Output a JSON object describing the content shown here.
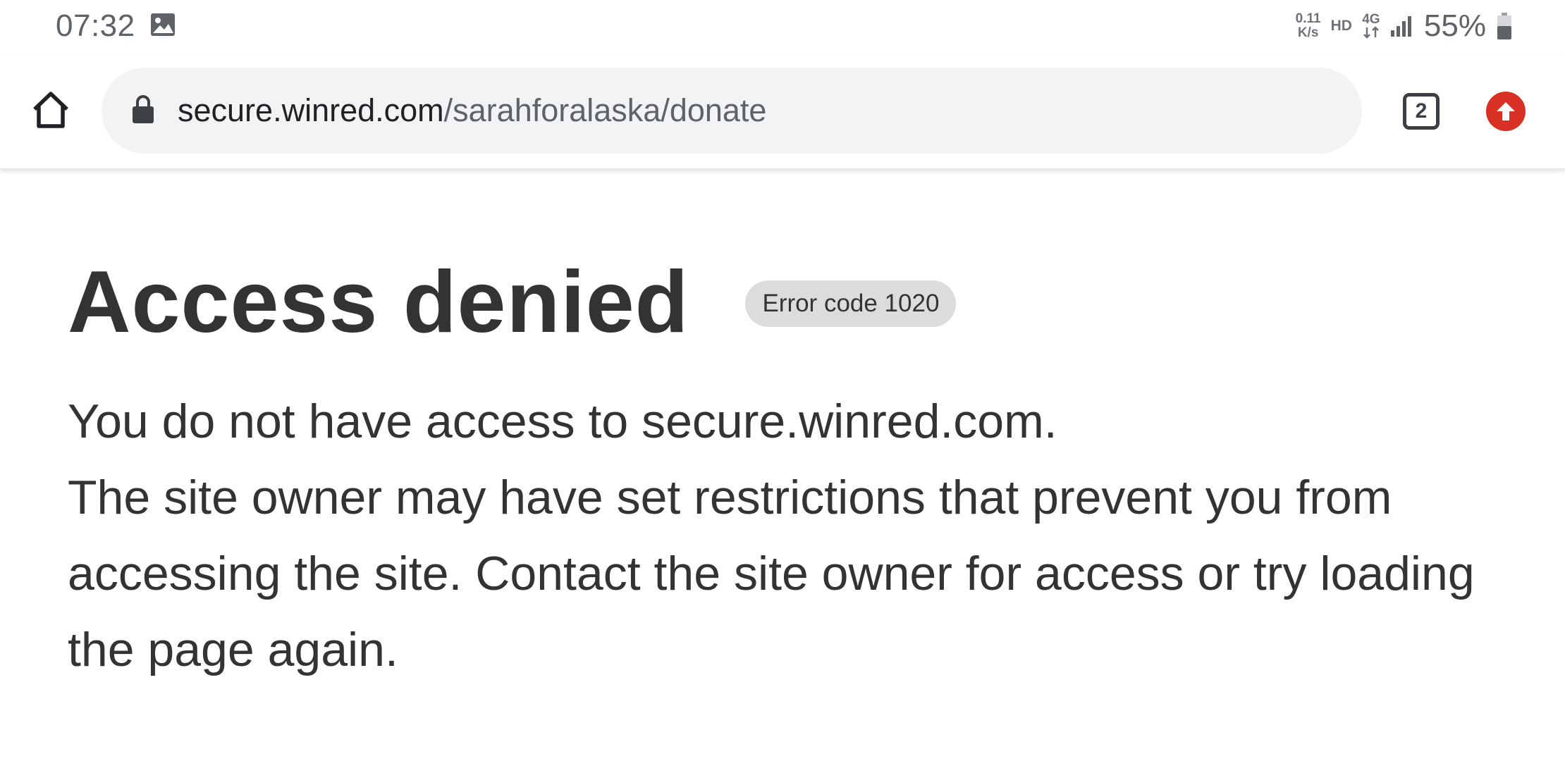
{
  "status_bar": {
    "time": "07:32",
    "net_speed_value": "0.11",
    "net_speed_unit": "K/s",
    "hd": "HD",
    "network_type": "4G",
    "battery": "55%"
  },
  "browser": {
    "url_domain": "secure.winred.com",
    "url_path": "/sarahforalaska/donate",
    "tab_count": "2"
  },
  "page": {
    "title": "Access denied",
    "error_badge": "Error code 1020",
    "line1": "You do not have access to secure.winred.com.",
    "line2": "The site owner may have set restrictions that prevent you from accessing the site. Contact the site owner for access or try loading the page again."
  },
  "colors": {
    "update_badge": "#d93025",
    "url_bar_bg": "#f1f3f4",
    "text": "#333333"
  }
}
